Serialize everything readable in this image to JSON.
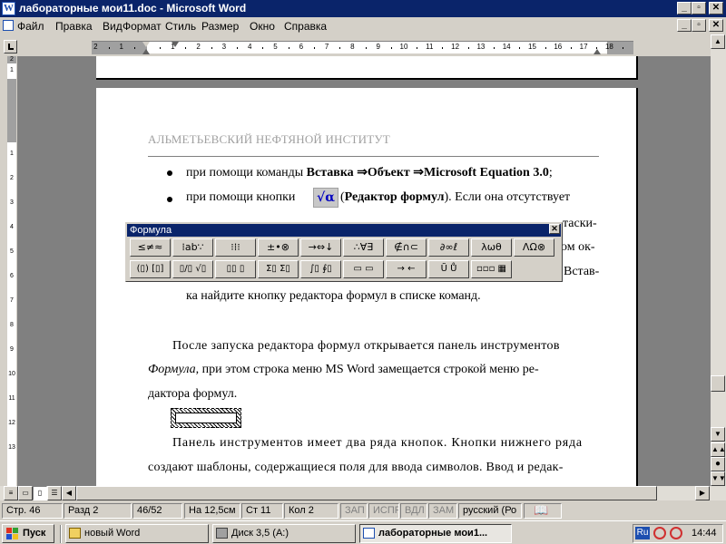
{
  "window": {
    "title": "лабораторные мои11.doc - Microsoft Word",
    "icon": "word-doc-icon",
    "controls": [
      "minimize",
      "maximize",
      "close"
    ]
  },
  "menu": [
    "Файл",
    "Правка",
    "Вид",
    "Формат",
    "Стиль",
    "Размер",
    "Окно",
    "Справка"
  ],
  "ruler": {
    "numbers": [
      "2",
      "1",
      "1",
      "2",
      "3",
      "4",
      "5",
      "6",
      "7",
      "8",
      "9",
      "10",
      "11",
      "12",
      "13",
      "14",
      "15",
      "16",
      "17",
      "18"
    ],
    "vertical_numbers": [
      "2",
      "1",
      "1",
      "2",
      "3",
      "4",
      "5",
      "6",
      "7",
      "8",
      "9",
      "10",
      "11",
      "12",
      "13"
    ]
  },
  "document": {
    "header_text": "АЛЬМЕТЬЕВСКИЙ НЕФТЯНОЙ ИНСТИТУТ",
    "bullet1": {
      "prefix": "при помощи команды ",
      "b1": "Вставка",
      "arrow": " ⇒",
      "b2": "Объект",
      "b3": "Microsoft Equation 3.0",
      "suffix": ";"
    },
    "bullet2": {
      "prefix": "при помощи кнопки",
      "icon": "√α",
      "open": "(",
      "bold": "Редактор формул",
      "suffix": "). Если она отсутствует"
    },
    "peek": [
      "таски-",
      "ом ок-",
      "Встав-"
    ],
    "line_after_toolbar": "ка найдите кнопку редактора формул в списке команд.",
    "para1": [
      "После запуска редактора формул открывается панель инструментов",
      ", при этом строка меню MS Word замещается строкой меню ре-",
      "дактора формул."
    ],
    "para1_italic": "Формула",
    "para2": [
      "Панель инструментов имеет два ряда кнопок. Кнопки нижнего ряда",
      "создают шаблоны, содержащиеся поля для ввода символов. Ввод и редак-"
    ]
  },
  "equation_toolbar": {
    "title": "Формула",
    "row1": [
      "≤≠≈",
      "⁞ab∵",
      "⁝⁞⁝",
      "±•⊗",
      "→⇔↓",
      "∴∀∃",
      "∉∩⊂",
      "∂∞ℓ",
      "λωθ",
      "ΛΩ⊗"
    ],
    "row2": [
      "(▯) [▯]",
      "▯/▯ √▯",
      "▯▯ ▯",
      "Σ▯ Σ▯",
      "∫▯ ∮▯",
      "▭ ▭",
      "→ ←",
      "Ũ Ů",
      "▫▫▫ ▦"
    ]
  },
  "status_bar": {
    "page": "Стр. 46",
    "section": "Разд 2",
    "pages": "46/52",
    "at": "На 12,5см",
    "line": "Ст 11",
    "col": "Кол 2",
    "rec": "ЗАП",
    "trk": "ИСПР",
    "ext": "ВДЛ",
    "ovr": "ЗАМ",
    "language": "русский (Ро"
  },
  "taskbar": {
    "start": "Пуск",
    "items": [
      "новый Word",
      "Диск 3,5 (A:)",
      "лабораторные мои1..."
    ],
    "active_index": 2,
    "lang": "Ru",
    "clock": "14:44"
  }
}
